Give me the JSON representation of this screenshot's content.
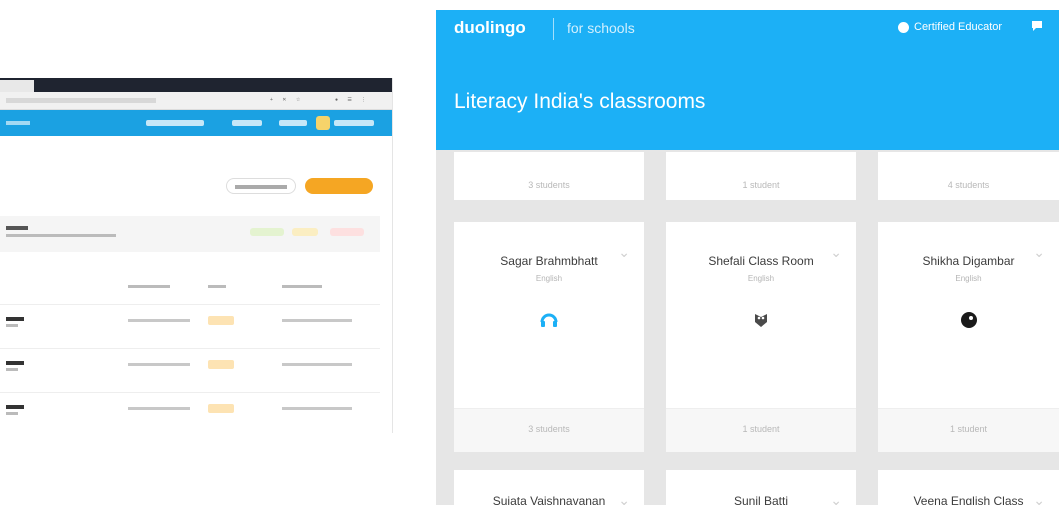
{
  "app": {
    "logo": "duolingo",
    "subbrand": "for schools",
    "support_label": "Certified Educator",
    "page_title": "Literacy India's classrooms"
  },
  "top_cards": [
    {
      "students": "3 students"
    },
    {
      "students": "1 student"
    },
    {
      "students": "4 students"
    }
  ],
  "cards": [
    {
      "title": "Sagar Brahmbhatt",
      "language": "English",
      "students": "3 students",
      "avatar": "headphones-avatar-icon"
    },
    {
      "title": "Shefali Class Room",
      "language": "English",
      "students": "1 student",
      "avatar": "bird-avatar-icon"
    },
    {
      "title": "Shikha Digambar",
      "language": "English",
      "students": "1 student",
      "avatar": "round-avatar-icon"
    }
  ],
  "bottom_cards": [
    {
      "title": "Sujata Vaishnavanan"
    },
    {
      "title": "Sunil Batti"
    },
    {
      "title": "Veena English Class"
    }
  ],
  "colors": {
    "brand_blue": "#1cb0f6",
    "accent_orange": "#f5a623",
    "left_appbar": "#1ba1e2"
  }
}
